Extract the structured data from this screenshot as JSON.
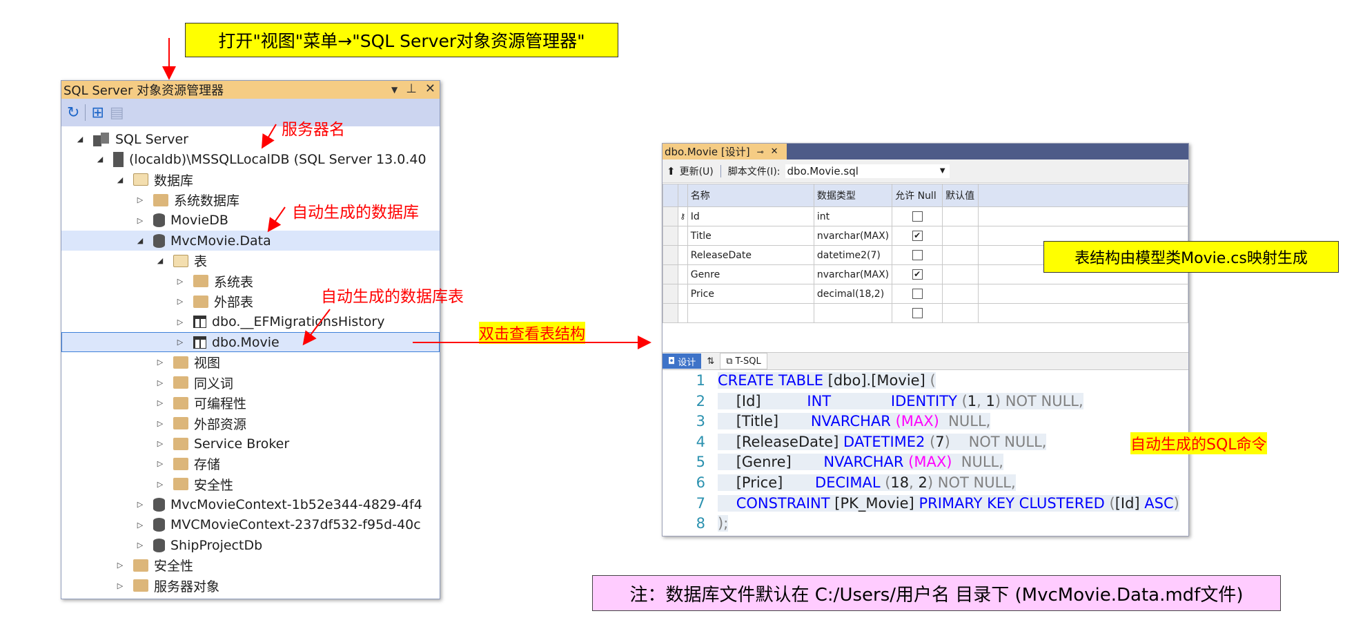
{
  "callouts": {
    "open_menu": "打开\"视图\"菜单→\"SQL Server对象资源管理器\"",
    "server_name": "服务器名",
    "auto_db": "自动生成的数据库",
    "auto_table": "自动生成的数据库表",
    "double_click": "双击查看表结构",
    "table_structure": "表结构由模型类Movie.cs映射生成",
    "auto_sql": "自动生成的SQL命令",
    "note": "注：数据库文件默认在 C:/Users/用户名 目录下 (MvcMovie.Data.mdf文件)"
  },
  "explorer": {
    "title": "SQL Server 对象资源管理器",
    "title_icons": [
      "dropdown-icon",
      "pin-icon",
      "close-icon"
    ],
    "toolbar": [
      "refresh-icon",
      "add-server-icon",
      "filter-icon"
    ],
    "tree": [
      {
        "label": "SQL Server",
        "level": 0,
        "expanded": true,
        "icon": "servers"
      },
      {
        "label": "(localdb)\\MSSQLLocalDB (SQL Server 13.0.40",
        "level": 1,
        "expanded": true,
        "icon": "server"
      },
      {
        "label": "数据库",
        "level": 2,
        "expanded": true,
        "icon": "folder-open"
      },
      {
        "label": "系统数据库",
        "level": 3,
        "expanded": false,
        "icon": "folder"
      },
      {
        "label": "MovieDB",
        "level": 3,
        "expanded": false,
        "icon": "db"
      },
      {
        "label": "MvcMovie.Data",
        "level": 3,
        "expanded": true,
        "icon": "db",
        "state": "selected"
      },
      {
        "label": "表",
        "level": 4,
        "expanded": true,
        "icon": "folder-open"
      },
      {
        "label": "系统表",
        "level": 5,
        "expanded": false,
        "icon": "folder"
      },
      {
        "label": "外部表",
        "level": 5,
        "expanded": false,
        "icon": "folder"
      },
      {
        "label": "dbo.__EFMigrationsHistory",
        "level": 5,
        "expanded": false,
        "icon": "table"
      },
      {
        "label": "dbo.Movie",
        "level": 5,
        "expanded": false,
        "icon": "table",
        "state": "focused"
      },
      {
        "label": "视图",
        "level": 4,
        "expanded": false,
        "icon": "folder"
      },
      {
        "label": "同义词",
        "level": 4,
        "expanded": false,
        "icon": "folder"
      },
      {
        "label": "可编程性",
        "level": 4,
        "expanded": false,
        "icon": "folder"
      },
      {
        "label": "外部资源",
        "level": 4,
        "expanded": false,
        "icon": "folder"
      },
      {
        "label": "Service Broker",
        "level": 4,
        "expanded": false,
        "icon": "folder"
      },
      {
        "label": "存储",
        "level": 4,
        "expanded": false,
        "icon": "folder"
      },
      {
        "label": "安全性",
        "level": 4,
        "expanded": false,
        "icon": "folder"
      },
      {
        "label": "MvcMovieContext-1b52e344-4829-4f4",
        "level": 3,
        "expanded": false,
        "icon": "db"
      },
      {
        "label": "MVCMovieContext-237df532-f95d-40c",
        "level": 3,
        "expanded": false,
        "icon": "db"
      },
      {
        "label": "ShipProjectDb",
        "level": 3,
        "expanded": false,
        "icon": "db"
      },
      {
        "label": "安全性",
        "level": 2,
        "expanded": false,
        "icon": "folder"
      },
      {
        "label": "服务器对象",
        "level": 2,
        "expanded": false,
        "icon": "folder"
      }
    ]
  },
  "designer": {
    "tab_title": "dbo.Movie [设计]",
    "tab_pin": "⊸",
    "tab_close": "✕",
    "update_button": "更新(U)",
    "script_file_label": "脚本文件(I):",
    "script_file_value": "dbo.Movie.sql",
    "columns": [
      "名称",
      "数据类型",
      "允许 Null",
      "默认值"
    ],
    "rows": [
      {
        "name": "Id",
        "type": "int",
        "nullable": false,
        "key": true
      },
      {
        "name": "Title",
        "type": "nvarchar(MAX)",
        "nullable": true,
        "key": false
      },
      {
        "name": "ReleaseDate",
        "type": "datetime2(7)",
        "nullable": false,
        "key": false
      },
      {
        "name": "Genre",
        "type": "nvarchar(MAX)",
        "nullable": true,
        "key": false
      },
      {
        "name": "Price",
        "type": "decimal(18,2)",
        "nullable": false,
        "key": false
      },
      {
        "name": "",
        "type": "",
        "nullable": false,
        "key": false
      }
    ],
    "bottom_tabs": [
      "设计",
      "⇅",
      "T-SQL"
    ],
    "code_lines": [
      {
        "n": "1",
        "parts": [
          [
            "kw",
            "CREATE TABLE "
          ],
          [
            "",
            "[dbo]."
          ],
          [
            "",
            "[Movie] "
          ],
          [
            "gr",
            "("
          ]
        ]
      },
      {
        "n": "2",
        "parts": [
          [
            "",
            "    [Id]          "
          ],
          [
            "kw",
            "INT"
          ],
          [
            "",
            "             "
          ],
          [
            "kw",
            "IDENTITY "
          ],
          [
            "gr",
            "("
          ],
          [
            "",
            "1"
          ],
          [
            "gr",
            ", "
          ],
          [
            "",
            "1"
          ],
          [
            "gr",
            ") NOT NULL,"
          ]
        ]
      },
      {
        "n": "3",
        "parts": [
          [
            "",
            "    [Title]       "
          ],
          [
            "kw",
            "NVARCHAR "
          ],
          [
            "fn",
            "(MAX)"
          ],
          [
            "gr",
            "  NULL,"
          ]
        ]
      },
      {
        "n": "4",
        "parts": [
          [
            "",
            "    [ReleaseDate] "
          ],
          [
            "kw",
            "DATETIME2 "
          ],
          [
            "gr",
            "("
          ],
          [
            "",
            "7"
          ],
          [
            "gr",
            ")    NOT NULL,"
          ]
        ]
      },
      {
        "n": "5",
        "parts": [
          [
            "",
            "    [Genre]       "
          ],
          [
            "kw",
            "NVARCHAR "
          ],
          [
            "fn",
            "(MAX)"
          ],
          [
            "gr",
            "  NULL,"
          ]
        ]
      },
      {
        "n": "6",
        "parts": [
          [
            "",
            "    [Price]       "
          ],
          [
            "kw",
            "DECIMAL "
          ],
          [
            "gr",
            "("
          ],
          [
            "",
            "18"
          ],
          [
            "gr",
            ", "
          ],
          [
            "",
            "2"
          ],
          [
            "gr",
            ") NOT NULL,"
          ]
        ]
      },
      {
        "n": "7",
        "parts": [
          [
            "",
            "    "
          ],
          [
            "kw",
            "CONSTRAINT "
          ],
          [
            "",
            "[PK_Movie] "
          ],
          [
            "kw",
            "PRIMARY KEY CLUSTERED "
          ],
          [
            "gr",
            "("
          ],
          [
            "",
            "[Id] "
          ],
          [
            "kw",
            "ASC"
          ],
          [
            "gr",
            ")"
          ]
        ]
      },
      {
        "n": "8",
        "parts": [
          [
            "gr",
            ");"
          ]
        ]
      }
    ]
  },
  "colors": {
    "callout_yellow": "#ffff00",
    "note_pink": "#ffccff",
    "arrow_red": "#ff0000",
    "explorer_title": "#f5cc84",
    "selection": "#dbe6fb"
  }
}
